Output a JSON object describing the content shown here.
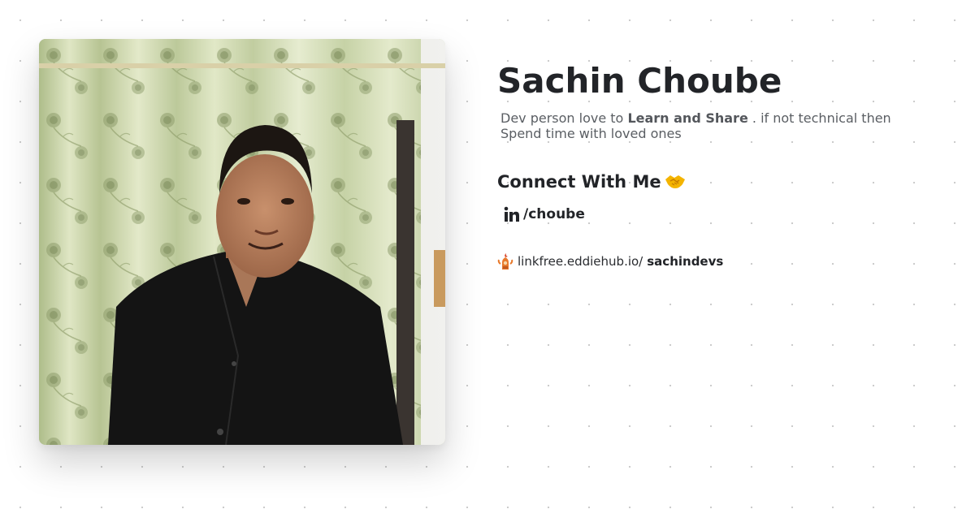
{
  "profile": {
    "name": "Sachin Choube",
    "photo_alt": "Profile photo of Sachin Choube",
    "bio": {
      "prefix": "Dev person love to",
      "highlight": "Learn and Share",
      "suffix": ". if not technical then Spend time with loved ones"
    }
  },
  "connect": {
    "heading": "Connect With Me",
    "heading_icon": "handshake-icon",
    "links": [
      {
        "icon": "linkedin-icon",
        "label": "/choube"
      }
    ]
  },
  "linkfree": {
    "icon": "linkfree-logo-icon",
    "domain": "linkfree.eddiehub.io/",
    "username": "sachindevs"
  }
}
